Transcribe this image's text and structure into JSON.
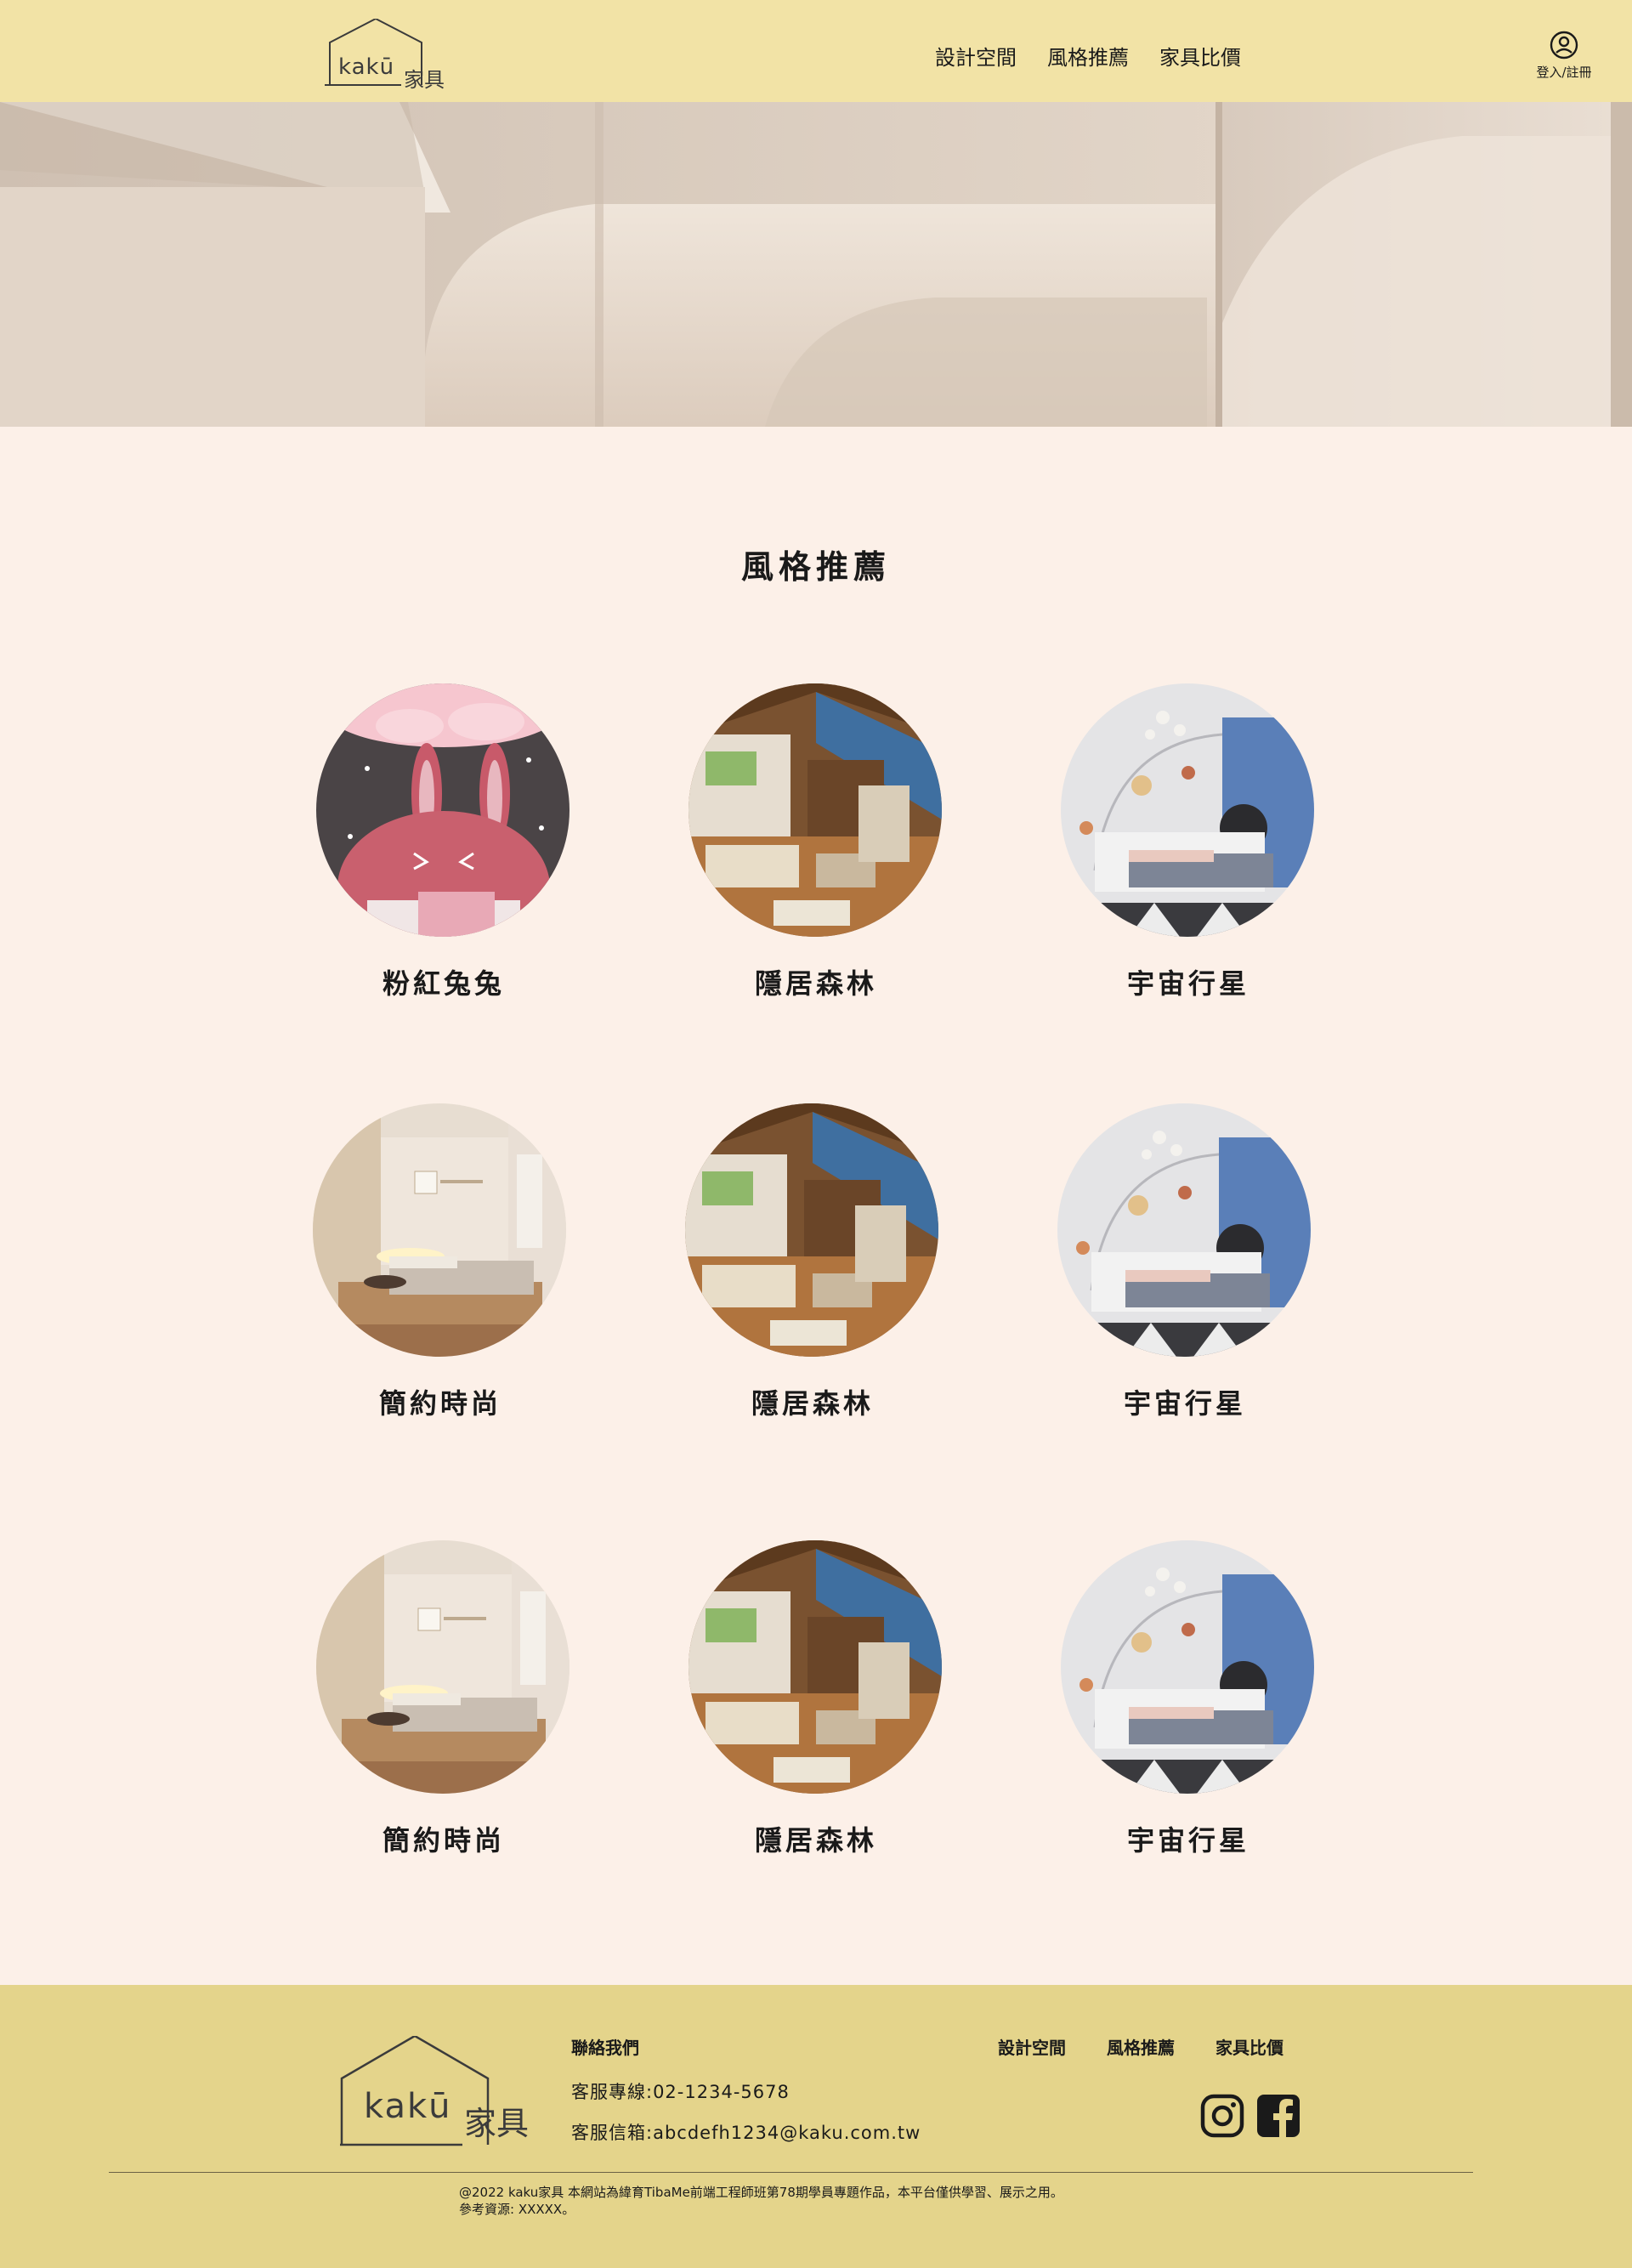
{
  "header": {
    "logo_text": "kakū",
    "logo_sub": "家具",
    "nav": [
      "設計空間",
      "風格推薦",
      "家具比價"
    ],
    "user_label": "登入/註冊",
    "background": "#f2e3a6"
  },
  "main": {
    "title": "風格推薦",
    "cards": [
      {
        "label": "粉紅兔兔",
        "image": "pink-bunny-room"
      },
      {
        "label": "隱居森林",
        "image": "forest-loft-room"
      },
      {
        "label": "宇宙行星",
        "image": "space-planet-room"
      },
      {
        "label": "簡約時尚",
        "image": "minimal-bedroom"
      },
      {
        "label": "隱居森林",
        "image": "forest-loft-room"
      },
      {
        "label": "宇宙行星",
        "image": "space-planet-room"
      },
      {
        "label": "簡約時尚",
        "image": "minimal-bedroom"
      },
      {
        "label": "隱居森林",
        "image": "forest-loft-room"
      },
      {
        "label": "宇宙行星",
        "image": "space-planet-room"
      }
    ]
  },
  "footer": {
    "logo_text": "kakū",
    "logo_sub": "家具",
    "contact_title": "聯絡我們",
    "phone": "客服專線:02-1234-5678",
    "email": "客服信箱:abcdefh1234@kaku.com.tw",
    "nav": [
      "設計空間",
      "風格推薦",
      "家具比價"
    ],
    "social": [
      "instagram-icon",
      "facebook-icon"
    ],
    "copyright_line1": "@2022 kaku家具 本網站為緯育TibaMe前端工程師班第78期學員專題作品，本平台僅供學習、展示之用。",
    "copyright_line2": "參考資源: XXXXX。",
    "background": "#e4d48b"
  }
}
